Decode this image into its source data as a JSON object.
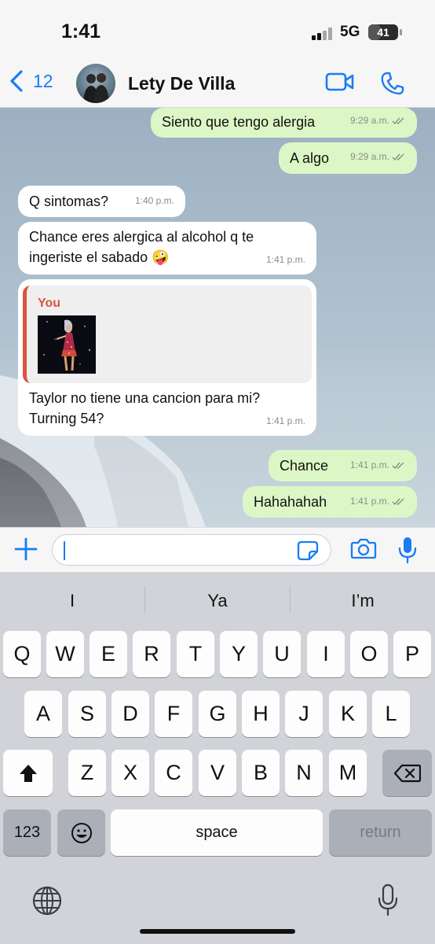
{
  "status_bar": {
    "time": "1:41",
    "network": "5G",
    "battery": "41",
    "battery_level": 0.41
  },
  "header": {
    "back_count": "12",
    "contact_name": "Lety De Villa",
    "icons": [
      "chevron-left-icon",
      "video-call-icon",
      "phone-call-icon"
    ],
    "accent_color": "#1a7cf5"
  },
  "messages": [
    {
      "direction": "out",
      "text": "Siento que tengo alergia",
      "time": "9:29 a.m.",
      "read": true
    },
    {
      "direction": "out",
      "text": "A algo",
      "time": "9:29 a.m.",
      "read": true
    },
    {
      "direction": "in",
      "text": "Q sintomas?",
      "time": "1:40 p.m."
    },
    {
      "direction": "in",
      "text": "Chance eres alergica al alcohol q te ingeriste el sabado 🤪",
      "time": "1:41 p.m."
    },
    {
      "direction": "in",
      "quote_author": "You",
      "quote_thumbnail": "concert-photo",
      "text": "Taylor no tiene una cancion para mi? Turning 54?",
      "time": "1:41 p.m."
    },
    {
      "direction": "out",
      "text": "Chance",
      "time": "1:41 p.m.",
      "read": true
    },
    {
      "direction": "out",
      "text": "Hahahahah",
      "time": "1:41 p.m.",
      "read": true
    }
  ],
  "composer": {
    "value": "",
    "icons": [
      "plus-icon",
      "sticker-icon",
      "camera-icon",
      "microphone-icon"
    ]
  },
  "keyboard": {
    "suggestions": [
      "I",
      "Ya",
      "I’m"
    ],
    "row1": [
      "Q",
      "W",
      "E",
      "R",
      "T",
      "Y",
      "U",
      "I",
      "O",
      "P"
    ],
    "row2": [
      "A",
      "S",
      "D",
      "F",
      "G",
      "H",
      "J",
      "K",
      "L"
    ],
    "row3": [
      "Z",
      "X",
      "C",
      "V",
      "B",
      "N",
      "M"
    ],
    "numbers_key": "123",
    "space_key": "space",
    "return_key": "return"
  },
  "colors": {
    "outgoing_bubble": "#dcf7c5",
    "incoming_bubble": "#ffffff",
    "quote_accent": "#d9553d",
    "read_ticks": "#8c8c8c"
  }
}
